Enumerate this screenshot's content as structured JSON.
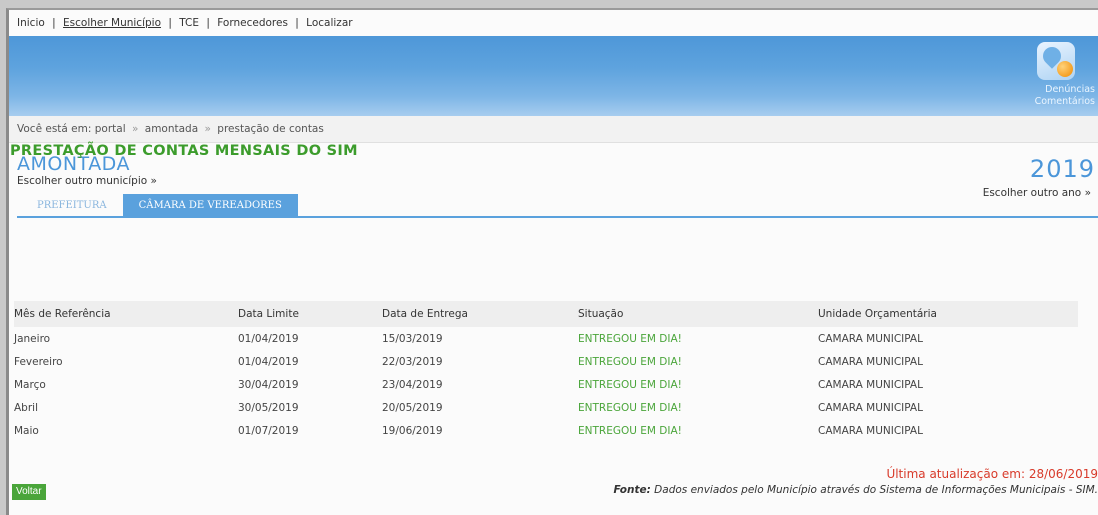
{
  "topnav": {
    "items": [
      "Inicio",
      "Escolher Município",
      "TCE",
      "Fornecedores",
      "Localizar"
    ],
    "separator": "|"
  },
  "banner": {
    "icon": "denuncias-cloud-icon",
    "label_line1": "Denúncias",
    "label_line2": "Comentários"
  },
  "breadcrumb": {
    "prefix": "Você está em:",
    "items": [
      "portal",
      "amontada",
      "prestação de contas"
    ],
    "arrow": "»"
  },
  "municipality": {
    "name": "AMONTADA",
    "change_link": "Escolher outro município »"
  },
  "year": {
    "value": "2019",
    "change_link": "Escolher outro ano »"
  },
  "tabs": [
    {
      "label": "PREFEITURA",
      "active": false
    },
    {
      "label": "CÂMARA DE VEREADORES",
      "active": true
    }
  ],
  "section_title": "PRESTAÇÃO DE CONTAS MENSAIS DO SIM",
  "table": {
    "headers": [
      "Mês de Referência",
      "Data Limite",
      "Data de Entrega",
      "Situação",
      "Unidade Orçamentária"
    ],
    "rows": [
      [
        "Janeiro",
        "01/04/2019",
        "15/03/2019",
        "ENTREGOU EM DIA!",
        "CAMARA MUNICIPAL"
      ],
      [
        "Fevereiro",
        "01/04/2019",
        "22/03/2019",
        "ENTREGOU EM DIA!",
        "CAMARA MUNICIPAL"
      ],
      [
        "Março",
        "30/04/2019",
        "23/04/2019",
        "ENTREGOU EM DIA!",
        "CAMARA MUNICIPAL"
      ],
      [
        "Abril",
        "30/05/2019",
        "20/05/2019",
        "ENTREGOU EM DIA!",
        "CAMARA MUNICIPAL"
      ],
      [
        "Maio",
        "01/07/2019",
        "19/06/2019",
        "ENTREGOU EM DIA!",
        "CAMARA MUNICIPAL"
      ]
    ]
  },
  "footer": {
    "updated": "Última atualização em: 28/06/2019",
    "source_label": "Fonte:",
    "source_text": "Dados enviados pelo Município através do Sistema de Informações Municipais - SIM.",
    "back_button": "Voltar"
  },
  "colors": {
    "accent_blue": "#4b96d9",
    "status_green": "#4aa53a",
    "title_green": "#3c9c2c",
    "updated_red": "#d83a2a"
  }
}
